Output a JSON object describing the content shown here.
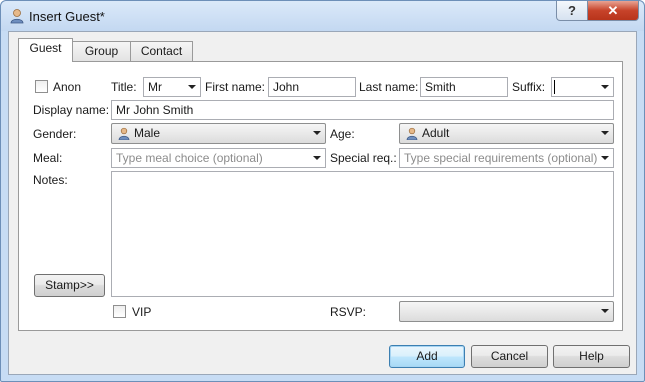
{
  "window": {
    "title": "Insert Guest*",
    "help_label": "?",
    "close_label": "✕"
  },
  "tabs": [
    {
      "label": "Guest",
      "active": true
    },
    {
      "label": "Group",
      "active": false
    },
    {
      "label": "Contact",
      "active": false
    }
  ],
  "form": {
    "anon_label": "Anon",
    "anon_checked": false,
    "title_label": "Title:",
    "title_value": "Mr",
    "first_name_label": "First name:",
    "first_name_value": "John",
    "last_name_label": "Last name:",
    "last_name_value": "Smith",
    "suffix_label": "Suffix:",
    "suffix_value": "",
    "display_name_label": "Display name:",
    "display_name_value": "Mr John Smith",
    "gender_label": "Gender:",
    "gender_value": "Male",
    "age_label": "Age:",
    "age_value": "Adult",
    "meal_label": "Meal:",
    "meal_placeholder": "Type meal choice (optional)",
    "special_req_label": "Special req.:",
    "special_req_placeholder": "Type special requirements (optional)",
    "notes_label": "Notes:",
    "notes_value": "",
    "stamp_button": "Stamp>>",
    "vip_label": "VIP",
    "vip_checked": false,
    "rsvp_label": "RSVP:",
    "rsvp_value": ""
  },
  "buttons": {
    "add": "Add",
    "cancel": "Cancel",
    "help": "Help"
  },
  "colors": {
    "title_bar": "#c7dcf4",
    "close_button": "#c7432a",
    "default_button_border": "#3c7fb1",
    "person_icon": "#e0a060"
  }
}
